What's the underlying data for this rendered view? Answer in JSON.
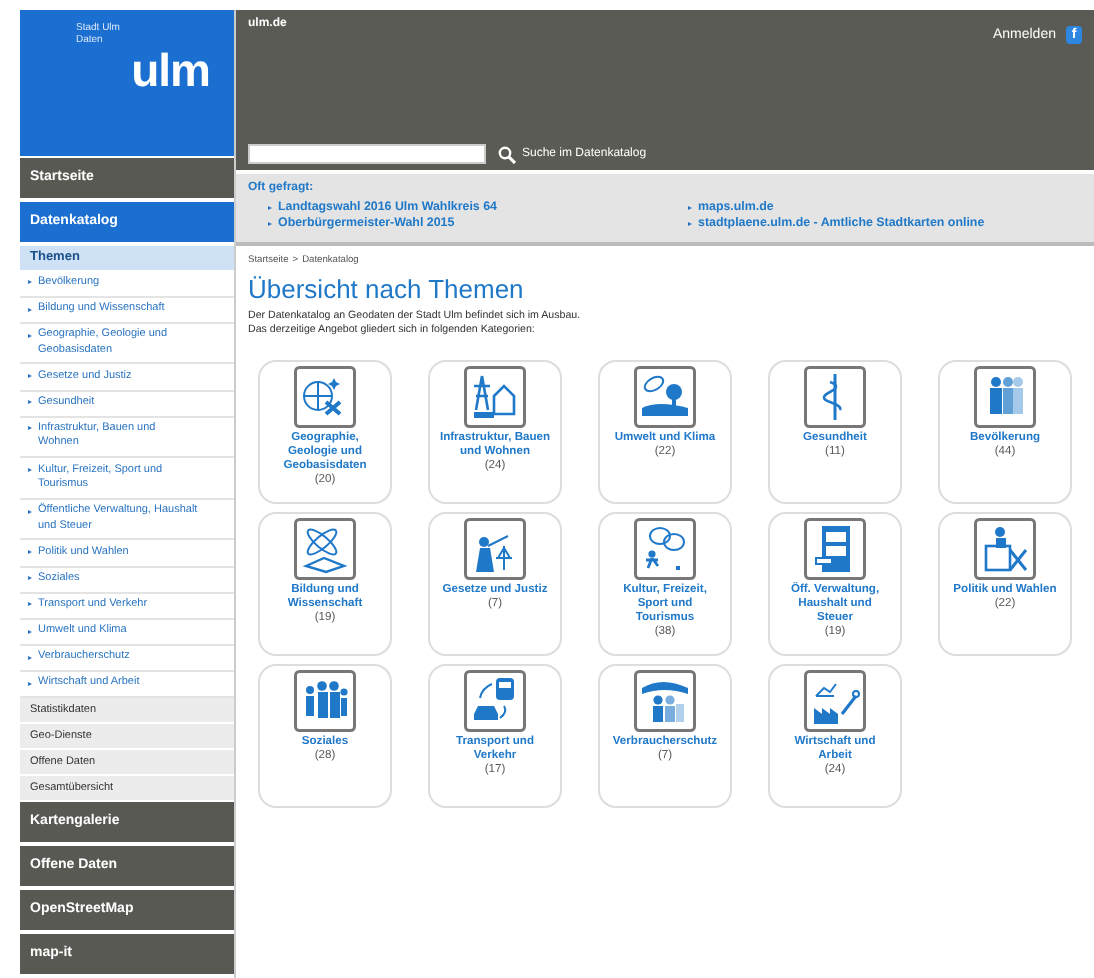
{
  "logo": {
    "subtitle_lines": [
      "Stadt Ulm",
      "Daten"
    ],
    "wordmark": "ulm"
  },
  "header": {
    "site_link": "ulm.de",
    "login": "Anmelden",
    "social_glyph": "f",
    "search": {
      "button_label": "Suche im Datenkatalog"
    }
  },
  "sidebar": {
    "items": [
      {
        "label": "Startseite",
        "selected": false
      },
      {
        "label": "Datenkatalog",
        "selected": true,
        "children": [
          {
            "label": "Themen",
            "selected": true,
            "children": [
              {
                "label": "Bevölkerung",
                "selected": false
              },
              {
                "label": "Bildung und Wissenschaft",
                "selected": false
              },
              {
                "label": "Geographie, Geologie und Geobasisdaten",
                "selected": false
              },
              {
                "label": "Gesetze und Justiz",
                "selected": false
              },
              {
                "label": "Gesundheit",
                "selected": false
              },
              {
                "label": "Infrastruktur, Bauen und Wohnen",
                "selected": false
              },
              {
                "label": "Kultur, Freizeit, Sport und Tourismus",
                "selected": false
              },
              {
                "label": "Öffentliche Verwaltung, Haushalt und Steuer",
                "selected": false
              },
              {
                "label": "Politik und Wahlen",
                "selected": false
              },
              {
                "label": "Soziales",
                "selected": false
              },
              {
                "label": "Transport und Verkehr",
                "selected": false
              },
              {
                "label": "Umwelt und Klima",
                "selected": false
              },
              {
                "label": "Verbraucherschutz",
                "selected": false
              },
              {
                "label": "Wirtschaft und Arbeit",
                "selected": false
              }
            ]
          },
          {
            "label": "Statistikdaten",
            "selected": false
          },
          {
            "label": "Geo-Dienste",
            "selected": false
          },
          {
            "label": "Offene Daten",
            "selected": false
          },
          {
            "label": "Gesamtübersicht",
            "selected": false
          }
        ]
      },
      {
        "label": "Kartengalerie",
        "selected": false
      },
      {
        "label": "Offene Daten",
        "selected": false
      },
      {
        "label": "OpenStreetMap",
        "selected": false
      },
      {
        "label": "map-it",
        "selected": false
      }
    ]
  },
  "faq": {
    "title": "Oft gefragt:",
    "columns": [
      [
        "Landtagswahl 2016 Ulm Wahlkreis 64",
        "Oberbürgermeister-Wahl 2015"
      ],
      [
        "maps.ulm.de",
        "stadtplaene.ulm.de - Amtliche Stadtkarten online"
      ]
    ]
  },
  "breadcrumb": [
    "Startseite",
    "Datenkatalog"
  ],
  "breadcrumb_separator": ">",
  "title": "Übersicht nach Themen",
  "intro": [
    "Der Datenkatalog an Geodaten der Stadt Ulm befindet sich  im Ausbau.",
    "Das derzeitige Angebot gliedert sich in folgenden Kategorien:"
  ],
  "categories": [
    {
      "label": "Geographie, Geologie und Geobasisdaten",
      "count": "(20)"
    },
    {
      "label": "Infrastruktur, Bauen und Wohnen",
      "count": "(24)"
    },
    {
      "label": "Umwelt und Klima",
      "count": "(22)"
    },
    {
      "label": "Gesundheit",
      "count": "(11)"
    },
    {
      "label": "Bevölkerung",
      "count": "(44)"
    },
    {
      "label": "Bildung und Wissenschaft",
      "count": "(19)"
    },
    {
      "label": "Gesetze und Justiz",
      "count": "(7)"
    },
    {
      "label": "Kultur, Freizeit, Sport und Tourismus",
      "count": "(38)"
    },
    {
      "label": "Öff. Verwaltung, Haushalt und Steuer",
      "count": "(19)"
    },
    {
      "label": "Politik und Wahlen",
      "count": "(22)"
    },
    {
      "label": "Soziales",
      "count": "(28)"
    },
    {
      "label": "Transport und Verkehr",
      "count": "(17)"
    },
    {
      "label": "Verbraucherschutz",
      "count": "(7)"
    },
    {
      "label": "Wirtschaft und Arbeit",
      "count": "(24)"
    }
  ]
}
